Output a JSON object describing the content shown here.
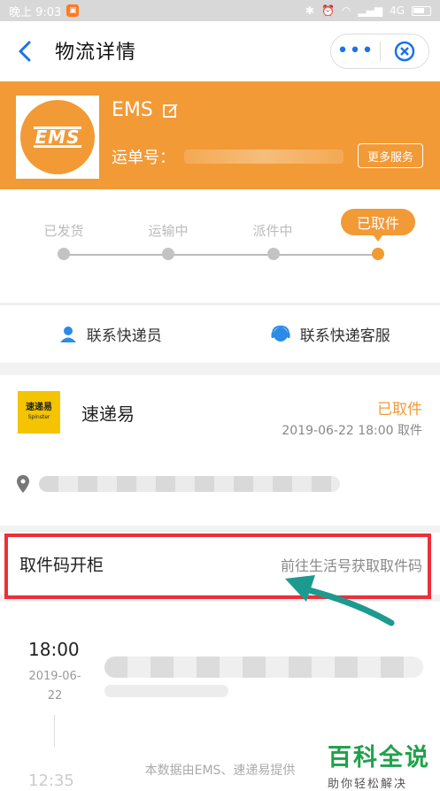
{
  "status_bar": {
    "left_text": "晚上 9:03",
    "network": "4G"
  },
  "nav": {
    "title": "物流详情",
    "more_glyph": "•••"
  },
  "banner": {
    "carrier": "EMS",
    "logo_text": "EMS",
    "tracking_label": "运单号：",
    "more_services": "更多服务",
    "bg_color": "#f29a36"
  },
  "progress": {
    "steps": [
      "已发货",
      "运输中",
      "派件中",
      "已取件"
    ],
    "current_index": 3
  },
  "contacts": {
    "courier": "联系快递员",
    "service": "联系快递客服"
  },
  "pickup": {
    "shop_logo_text": "速递易",
    "shop_logo_sub": "Spinster",
    "shop_name": "速递易",
    "status": "已取件",
    "time": "2019-06-22 18:00 取件"
  },
  "code_row": {
    "title": "取件码开柜",
    "hint": "前往生活号获取取件码"
  },
  "timeline": {
    "time": "18:00",
    "date_line1": "2019-06-",
    "date_line2": "22",
    "next_time": "12:35",
    "footer": "本数据由EMS、速递易提供"
  },
  "watermark": {
    "main": "百科全说",
    "sub": "助你轻松解决"
  }
}
